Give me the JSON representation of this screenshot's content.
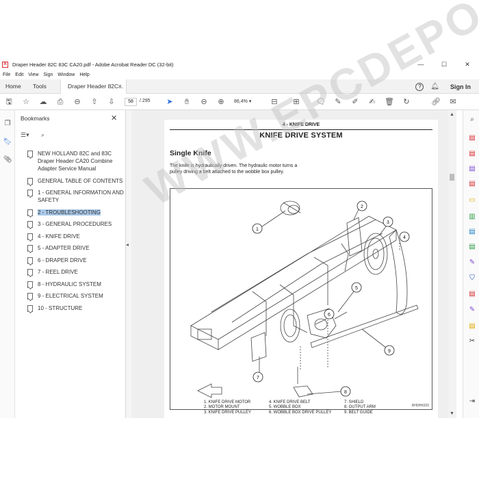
{
  "window": {
    "title": "Draper Header 82C 83C CA20.pdf - Adobe Acrobat Reader DC (32-bit)",
    "app_icon": "acrobat-icon",
    "min": "—",
    "max": "☐",
    "close": "✕"
  },
  "menu": [
    "File",
    "Edit",
    "View",
    "Sign",
    "Window",
    "Help"
  ],
  "tabs": {
    "home": "Home",
    "tools": "Tools",
    "doc": "Draper Header 82C...",
    "doc_close": "×",
    "help": "?",
    "sign_in": "Sign In"
  },
  "toolbar": {
    "page_current": "58",
    "page_total": "/ 295",
    "zoom": "86,4%",
    "zoom_caret": "▾",
    "icons": [
      "save-icon",
      "bookmark-star-icon",
      "upload-icon",
      "print-icon",
      "zoom-out-icon",
      "page-up-icon",
      "page-down-icon",
      "select-cursor-icon",
      "hand-icon",
      "minus-icon",
      "plus-icon",
      "fit-page-icon",
      "scroll-icon",
      "comment-icon",
      "highlight-icon",
      "draw-icon",
      "sign-icon",
      "delete-icon",
      "undo-icon",
      "share-link-icon",
      "email-icon"
    ]
  },
  "bookmarks": {
    "title": "Bookmarks",
    "close": "✕",
    "tools_icon": "☰▾",
    "find_icon": "⌕",
    "items": [
      {
        "label": "NEW HOLLAND 82C and 83C Draper Header CA20 Combine Adapter Service Manual",
        "active": false
      },
      {
        "label": "GENERAL TABLE OF CONTENTS",
        "active": false
      },
      {
        "label": "1 - GENERAL INFORMATION AND SAFETY",
        "active": false
      },
      {
        "label": "2 - TROUBLESHOOTING",
        "active": true
      },
      {
        "label": "3 - GENERAL PROCEDURES",
        "active": false
      },
      {
        "label": "4 - KNIFE DRIVE",
        "active": false
      },
      {
        "label": "5 - ADAPTER DRIVE",
        "active": false
      },
      {
        "label": "6 - DRAPER DRIVE",
        "active": false
      },
      {
        "label": "7 - REEL DRIVE",
        "active": false
      },
      {
        "label": "8 - HYDRAULIC SYSTEM",
        "active": false
      },
      {
        "label": "9 - ELECTRICAL SYSTEM",
        "active": false
      },
      {
        "label": "10 - STRUCTURE",
        "active": false
      }
    ]
  },
  "document": {
    "section": "4 - KNIFE DRIVE",
    "header": "KNIFE DRIVE SYSTEM",
    "heading": "Single Knife",
    "paragraph": "The knife is hydraulically driven. The hydraulic motor turns a pulley driving a belt attached to the wobble box pulley.",
    "figure_id": "RH0HK020",
    "callouts": [
      "1",
      "2",
      "3",
      "4",
      "5",
      "6",
      "7",
      "8",
      "9"
    ],
    "legend": [
      [
        "1. KNIFE DRIVE MOTOR",
        "2. MOTOR MOUNT",
        "3. KNIFE DRIVE PULLEY"
      ],
      [
        "4. KNIFE DRIVE BELT",
        "5. WOBBLE BOX",
        "6. WOBBLE BOX DRIVE PULLEY"
      ],
      [
        "7. SHIELD",
        "8. OUTPUT ARM",
        "9. BELT GUIDE"
      ]
    ],
    "watermark": "WWW.EPCDEPO.COM"
  },
  "scroll": {
    "up": "▲",
    "down": "▼",
    "collapse": "⇥"
  }
}
